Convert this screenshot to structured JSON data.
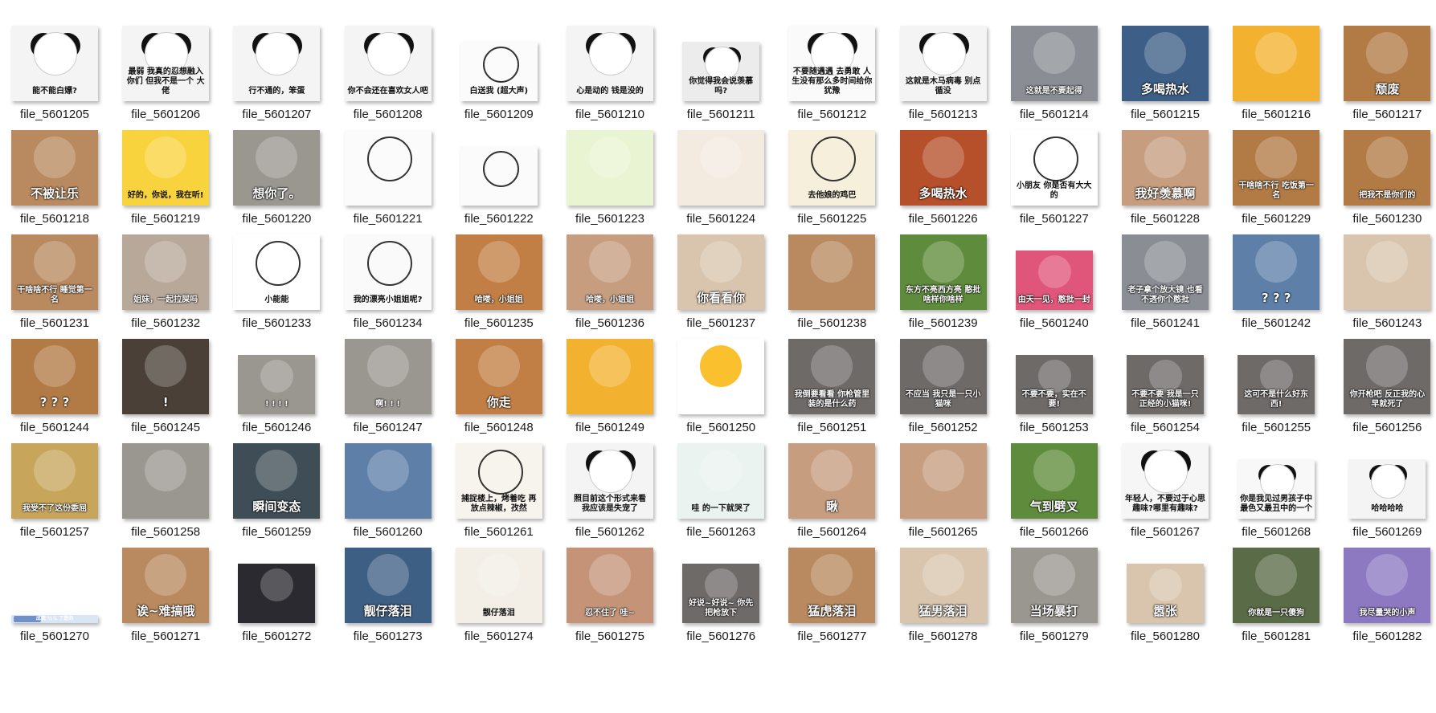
{
  "files": [
    {
      "name": "file_5601205",
      "caption": "能不能白嫖?",
      "kind": "panda",
      "shape": "square"
    },
    {
      "name": "file_5601206",
      "caption": "最弱 我真的忍想融入你们 但我不是一个 大佬",
      "kind": "panda",
      "shape": "square"
    },
    {
      "name": "file_5601207",
      "caption": "行不通的，笨蛋",
      "kind": "panda",
      "shape": "square"
    },
    {
      "name": "file_5601208",
      "caption": "你不会还在喜欢女人吧",
      "kind": "panda",
      "shape": "square"
    },
    {
      "name": "file_5601209",
      "caption": "白送我 (超大声)",
      "kind": "anime",
      "shape": "wide"
    },
    {
      "name": "file_5601210",
      "caption": "心是动的 钱是没的",
      "kind": "panda",
      "shape": "square"
    },
    {
      "name": "file_5601211",
      "caption": "你觉得我会说羡慕吗?",
      "kind": "panda-cry",
      "shape": "wide"
    },
    {
      "name": "file_5601212",
      "caption": "不要随遇遇 去勇敢 人生没有那么多时间给你犹豫",
      "kind": "panda-text",
      "shape": "square"
    },
    {
      "name": "file_5601213",
      "caption": "这就是木马病毒 别点循没",
      "kind": "panda",
      "shape": "square"
    },
    {
      "name": "file_5601214",
      "caption": "这就是不要起得",
      "kind": "photo-gray",
      "shape": "square"
    },
    {
      "name": "file_5601215",
      "caption": "多喝热水",
      "kind": "photo-blue",
      "shape": "square"
    },
    {
      "name": "file_5601216",
      "caption": "",
      "kind": "cartoon-cat",
      "shape": "square"
    },
    {
      "name": "file_5601217",
      "caption": "颓废",
      "kind": "photo-dog",
      "shape": "square"
    },
    {
      "name": "file_5601218",
      "caption": "不被让乐",
      "kind": "photo-cat",
      "shape": "square"
    },
    {
      "name": "file_5601219",
      "caption": "好的，你说，我在听!",
      "kind": "duck",
      "shape": "square"
    },
    {
      "name": "file_5601220",
      "caption": "想你了。",
      "kind": "photo-cat-gray",
      "shape": "square"
    },
    {
      "name": "file_5601221",
      "caption": "",
      "kind": "sketch",
      "shape": "square"
    },
    {
      "name": "file_5601222",
      "caption": "",
      "kind": "sketch",
      "shape": "wide"
    },
    {
      "name": "file_5601223",
      "caption": "",
      "kind": "green-smile",
      "shape": "square"
    },
    {
      "name": "file_5601224",
      "caption": "",
      "kind": "deer",
      "shape": "square"
    },
    {
      "name": "file_5601225",
      "caption": "去他娘的鸡巴",
      "kind": "sketch-beige",
      "shape": "square"
    },
    {
      "name": "file_5601226",
      "caption": "多喝热水",
      "kind": "photo-fire",
      "shape": "square"
    },
    {
      "name": "file_5601227",
      "caption": "小朋友 你是否有大大的",
      "kind": "question",
      "shape": "square"
    },
    {
      "name": "file_5601228",
      "caption": "我好羡慕啊",
      "kind": "photo-baby",
      "shape": "square"
    },
    {
      "name": "file_5601229",
      "caption": "干啥啥不行 吃饭第一名",
      "kind": "photo-dog",
      "shape": "square"
    },
    {
      "name": "file_5601230",
      "caption": "把我不是你们的",
      "kind": "photo-dog",
      "shape": "square"
    },
    {
      "name": "file_5601231",
      "caption": "干啥啥不行 睡觉第一名",
      "kind": "photo-cat",
      "shape": "square"
    },
    {
      "name": "file_5601232",
      "caption": "姐妹，一起拉屎吗",
      "kind": "photo-cat-door",
      "shape": "square"
    },
    {
      "name": "file_5601233",
      "caption": "小能能",
      "kind": "duck-fish",
      "shape": "square"
    },
    {
      "name": "file_5601234",
      "caption": "我的漂亮小姐姐呢?",
      "kind": "sketch-cat",
      "shape": "square"
    },
    {
      "name": "file_5601235",
      "caption": "哈喽，小姐姐",
      "kind": "photo-shiba",
      "shape": "square"
    },
    {
      "name": "file_5601236",
      "caption": "哈喽，小姐姐",
      "kind": "photo-baby",
      "shape": "square"
    },
    {
      "name": "file_5601237",
      "caption": "你看看你",
      "kind": "photo-cat-light",
      "shape": "square"
    },
    {
      "name": "file_5601238",
      "caption": "",
      "kind": "photo-cat",
      "shape": "square"
    },
    {
      "name": "file_5601239",
      "caption": "东方不亮西方亮 憨批啥样你啥样",
      "kind": "photo-green",
      "shape": "square"
    },
    {
      "name": "file_5601240",
      "caption": "由天一见，憨批一封",
      "kind": "pink-toy",
      "shape": "wide"
    },
    {
      "name": "file_5601241",
      "caption": "老子拿个放大镜 也看不透你个憨批",
      "kind": "photo-gray",
      "shape": "square"
    },
    {
      "name": "file_5601242",
      "caption": "? ? ?",
      "kind": "tom-blue",
      "shape": "square"
    },
    {
      "name": "file_5601243",
      "caption": "",
      "kind": "photo-cat-light",
      "shape": "square"
    },
    {
      "name": "file_5601244",
      "caption": "? ? ?",
      "kind": "photo-dog",
      "shape": "square"
    },
    {
      "name": "file_5601245",
      "caption": "!",
      "kind": "photo-shiba-dark",
      "shape": "square"
    },
    {
      "name": "file_5601246",
      "caption": "! ! ! !",
      "kind": "photo-cat-gray",
      "shape": "wide"
    },
    {
      "name": "file_5601247",
      "caption": "啊! ! !",
      "kind": "photo-cat-gray",
      "shape": "square"
    },
    {
      "name": "file_5601248",
      "caption": "你走",
      "kind": "photo-shiba",
      "shape": "square"
    },
    {
      "name": "file_5601249",
      "caption": "",
      "kind": "cartoon-cat",
      "shape": "square"
    },
    {
      "name": "file_5601250",
      "caption": "",
      "kind": "emoji-laugh",
      "shape": "square"
    },
    {
      "name": "file_5601251",
      "caption": "我倒要看看 你枪管里装的是什么药",
      "kind": "photo-cat-gun",
      "shape": "square"
    },
    {
      "name": "file_5601252",
      "caption": "不应当 我只是一只小猫咪",
      "kind": "photo-cat-gun",
      "shape": "square"
    },
    {
      "name": "file_5601253",
      "caption": "不要不要，实在不要!",
      "kind": "photo-cat-gun",
      "shape": "wide"
    },
    {
      "name": "file_5601254",
      "caption": "不要不要 我是一只正经的小猫咪!",
      "kind": "photo-cat-gun",
      "shape": "wide"
    },
    {
      "name": "file_5601255",
      "caption": "这可不是什么好东西!",
      "kind": "photo-cat-gun",
      "shape": "wide"
    },
    {
      "name": "file_5601256",
      "caption": "你开枪吧 反正我的心早就死了",
      "kind": "photo-cat-gun",
      "shape": "square"
    },
    {
      "name": "file_5601257",
      "caption": "我受不了这份委屈",
      "kind": "photo-cat-yellow",
      "shape": "square"
    },
    {
      "name": "file_5601258",
      "caption": "",
      "kind": "photo-cat-gray",
      "shape": "square"
    },
    {
      "name": "file_5601259",
      "caption": "瞬间变态",
      "kind": "tom-dark",
      "shape": "square"
    },
    {
      "name": "file_5601260",
      "caption": "",
      "kind": "tom-blue",
      "shape": "square"
    },
    {
      "name": "file_5601261",
      "caption": "捕捉楼上，烤着吃 再放点辣椒，孜然",
      "kind": "anime-white",
      "shape": "square"
    },
    {
      "name": "file_5601262",
      "caption": "照目前这个形式来看 我应该是失宠了",
      "kind": "panda",
      "shape": "square"
    },
    {
      "name": "file_5601263",
      "caption": "哇 的一下就哭了",
      "kind": "cry-face",
      "shape": "square"
    },
    {
      "name": "file_5601264",
      "caption": "瞅",
      "kind": "photo-baby",
      "shape": "square"
    },
    {
      "name": "file_5601265",
      "caption": "",
      "kind": "photo-baby",
      "shape": "square"
    },
    {
      "name": "file_5601266",
      "caption": "气到劈叉",
      "kind": "photo-green",
      "shape": "square"
    },
    {
      "name": "file_5601267",
      "caption": "年轻人，不要过于心思 趣味?哪里有趣味?",
      "kind": "panda-multi",
      "shape": "square"
    },
    {
      "name": "file_5601268",
      "caption": "你是我见过男孩子中 最色又最丑中的一个",
      "kind": "panda-pink",
      "shape": "wide"
    },
    {
      "name": "file_5601269",
      "caption": "哈哈哈哈",
      "kind": "panda",
      "shape": "wide"
    },
    {
      "name": "file_5601270",
      "caption": "成我 ½ L 了是的",
      "kind": "thin-strip",
      "shape": "strip"
    },
    {
      "name": "file_5601271",
      "caption": "诶~难搞哦",
      "kind": "photo-cat",
      "shape": "square"
    },
    {
      "name": "file_5601272",
      "caption": "",
      "kind": "phone-screen",
      "shape": "wide"
    },
    {
      "name": "file_5601273",
      "caption": "靓仔落泪",
      "kind": "jerry",
      "shape": "square"
    },
    {
      "name": "file_5601274",
      "caption": "靓仔落泪",
      "kind": "hamster",
      "shape": "square"
    },
    {
      "name": "file_5601275",
      "caption": "忍不住了 哇~",
      "kind": "photo-baby-cry",
      "shape": "square"
    },
    {
      "name": "file_5601276",
      "caption": "好说~好说~ 你先把枪放下",
      "kind": "photo-cat-gun",
      "shape": "wide"
    },
    {
      "name": "file_5601277",
      "caption": "猛虎落泪",
      "kind": "photo-cat",
      "shape": "square"
    },
    {
      "name": "file_5601278",
      "caption": "猛男落泪",
      "kind": "photo-cat-light",
      "shape": "square"
    },
    {
      "name": "file_5601279",
      "caption": "当场暴打",
      "kind": "photo-cat-gray",
      "shape": "square"
    },
    {
      "name": "file_5601280",
      "caption": "嚣张",
      "kind": "photo-cat-light",
      "shape": "wide"
    },
    {
      "name": "file_5601281",
      "caption": "你就是一只傻狗",
      "kind": "photo-dog-man",
      "shape": "square"
    },
    {
      "name": "file_5601282",
      "caption": "我尽量哭的小声",
      "kind": "jerry-purple",
      "shape": "square"
    }
  ],
  "colors": {
    "panda": "#f4f4f4",
    "panda-cry": "#ececec",
    "panda-text": "#fafafa",
    "panda-multi": "#f6f6f6",
    "panda-pink": "#f8f8f8",
    "anime": "#fbfbfb",
    "anime-white": "#f7f4ee",
    "photo-gray": "#8a8d93",
    "photo-blue": "#3d5e86",
    "cartoon-cat": "#f2b12e",
    "photo-dog": "#b27a45",
    "photo-cat": "#b98a5f",
    "duck": "#f9d33d",
    "photo-cat-gray": "#9a9690",
    "sketch": "#fbfbfb",
    "green-smile": "#e9f4d2",
    "deer": "#f3ebe0",
    "sketch-beige": "#f6efdc",
    "photo-fire": "#b5502a",
    "question": "#ffffff",
    "photo-baby": "#c69d7f",
    "photo-cat-door": "#b8a89a",
    "duck-fish": "#ffffff",
    "sketch-cat": "#fafafa",
    "photo-shiba": "#c27f45",
    "photo-cat-light": "#d9c5ae",
    "photo-green": "#5f8c3c",
    "pink-toy": "#e0557a",
    "tom-blue": "#5d7fa8",
    "photo-shiba-dark": "#4a4038",
    "emoji-laugh": "#ffffff",
    "photo-cat-gun": "#6e6a68",
    "photo-cat-yellow": "#c7a65b",
    "tom-dark": "#3f4e56",
    "cry-face": "#eaf3ef",
    "thin-strip": "#dbe6f5",
    "phone-screen": "#2a2a30",
    "jerry": "#3e5f84",
    "hamster": "#f3efe7",
    "photo-baby-cry": "#c59478",
    "photo-dog-man": "#5a6b47",
    "jerry-purple": "#8c79c2"
  }
}
